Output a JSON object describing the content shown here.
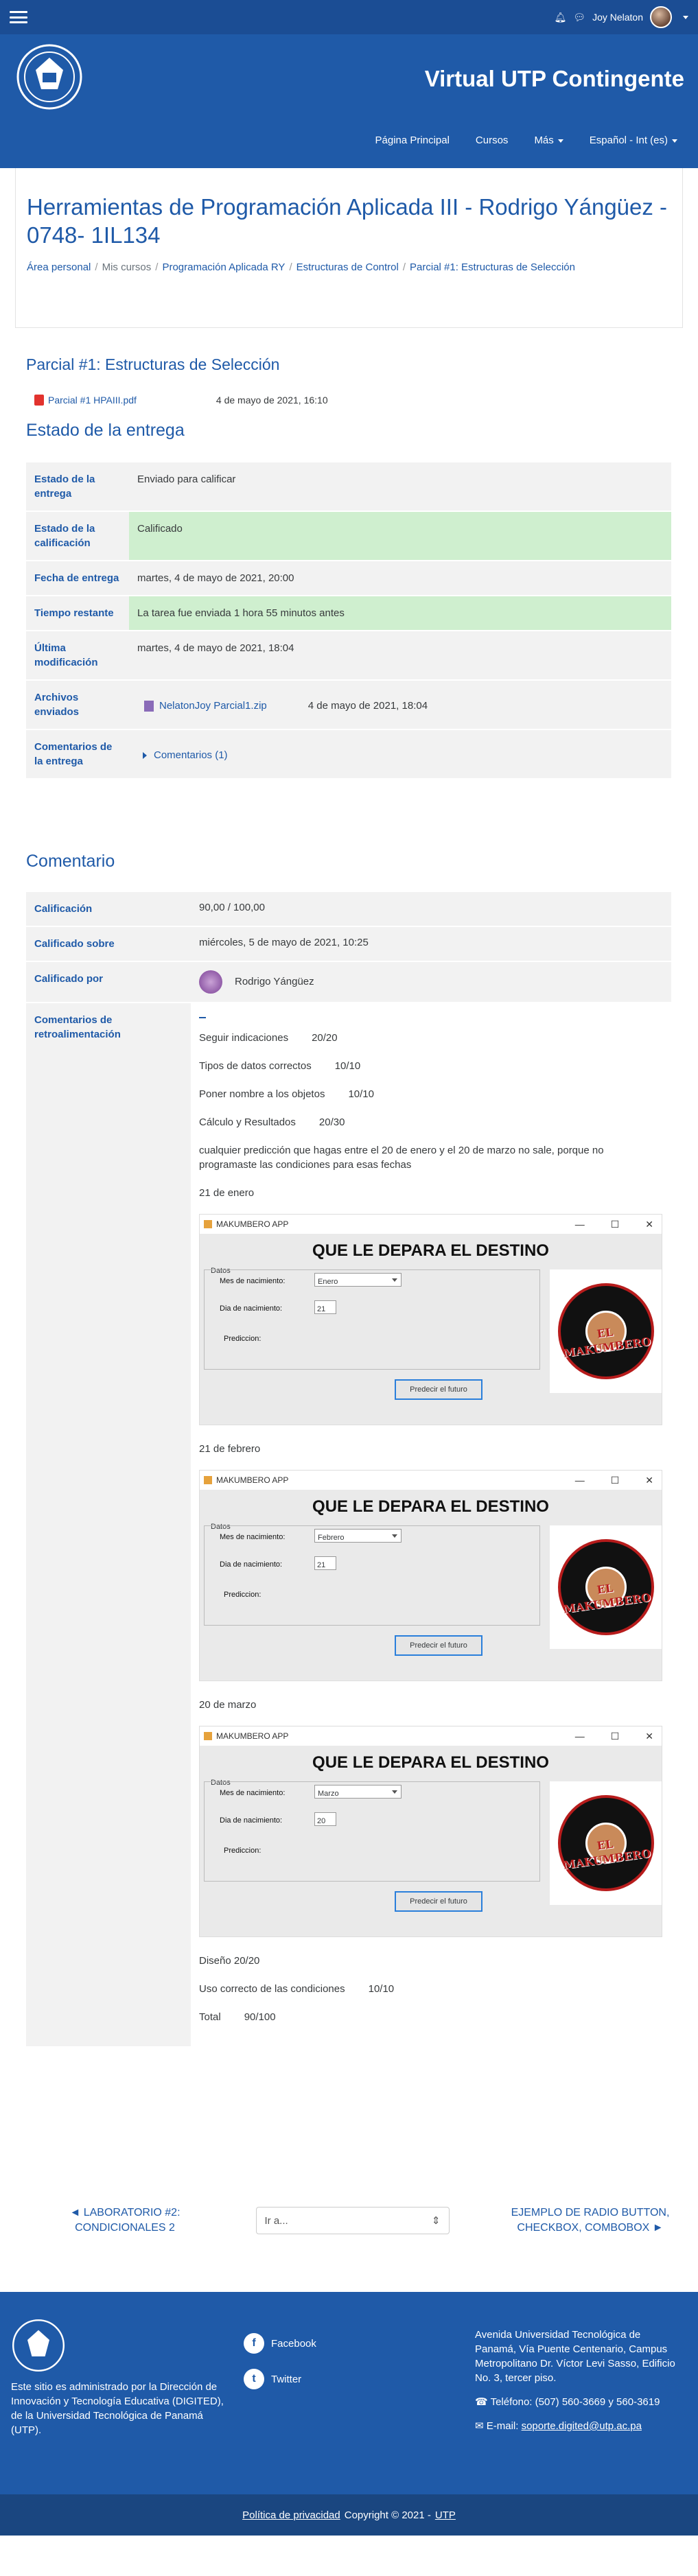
{
  "topbar": {
    "user_name": "Joy Nelaton"
  },
  "header": {
    "site_title": "Virtual UTP Contingente",
    "nav": [
      "Página Principal",
      "Cursos",
      "Más",
      "Español - Int (es)"
    ]
  },
  "course": {
    "title": "Herramientas de Programación Aplicada III - Rodrigo Yángüez - 0748- 1IL134",
    "breadcrumb": [
      "Área personal",
      "Mis cursos",
      "Programación Aplicada RY",
      "Estructuras de Control",
      "Parcial #1: Estructuras de Selección"
    ]
  },
  "activity": {
    "title": "Parcial #1: Estructuras de Selección",
    "file": "Parcial #1 HPAIII.pdf",
    "file_date": "4 de mayo de 2021, 16:10"
  },
  "submission": {
    "heading": "Estado de la entrega",
    "rows": [
      {
        "label": "Estado de la entrega",
        "value": "Enviado para calificar"
      },
      {
        "label": "Estado de la calificación",
        "value": "Calificado"
      },
      {
        "label": "Fecha de entrega",
        "value": "martes, 4 de mayo de 2021, 20:00"
      },
      {
        "label": "Tiempo restante",
        "value": "La tarea fue enviada 1 hora 55 minutos antes"
      },
      {
        "label": "Última modificación",
        "value": "martes, 4 de mayo de 2021, 18:04"
      }
    ],
    "files_label": "Archivos enviados",
    "zip_name": "NelatonJoy Parcial1.zip",
    "zip_date": "4 de mayo de 2021, 18:04",
    "comments_label": "Comentarios de la entrega",
    "comments_link": "Comentarios (1)"
  },
  "feedback": {
    "heading": "Comentario",
    "grade_label": "Calificación",
    "grade": "90,00 / 100,00",
    "graded_on_label": "Calificado sobre",
    "graded_on": "miércoles, 5 de mayo de 2021, 10:25",
    "graded_by_label": "Calificado por",
    "grader": "Rodrigo Yángüez",
    "comments_label": "Comentarios de retroalimentación",
    "items": [
      {
        "text": "Seguir indicaciones",
        "score": "20/20"
      },
      {
        "text": "Tipos de datos correctos",
        "score": "10/10"
      },
      {
        "text": "Poner nombre a los objetos",
        "score": "10/10"
      },
      {
        "text": "Cálculo y Resultados",
        "score": "20/30"
      }
    ],
    "note": "cualquier predicción que hagas entre el 20 de enero y el 20 de marzo no sale, porque no programaste las condiciones para esas fechas",
    "shots": [
      {
        "caption": "21 de enero",
        "month": "Enero",
        "day": "21"
      },
      {
        "caption": "21 de febrero",
        "month": "Febrero",
        "day": "21"
      },
      {
        "caption": "20 de marzo",
        "month": "Marzo",
        "day": "20"
      }
    ],
    "app": {
      "window_title": "MAKUMBERO APP",
      "heading": "QUE LE DEPARA EL DESTINO",
      "group": "Datos",
      "month_label": "Mes de nacimiento:",
      "day_label": "Dia de nacimiento:",
      "pred_label": "Prediccion:",
      "button": "Predecir el futuro",
      "logo_text": "EL MAKUMBERO"
    },
    "design": "Diseño 20/20",
    "cond": {
      "text": "Uso correcto de las condiciones",
      "score": "10/10"
    },
    "total": {
      "text": "Total",
      "score": "90/100"
    }
  },
  "activity_nav": {
    "prev": "◄ LABORATORIO #2: CONDICIONALES 2",
    "jump": "Ir a...",
    "next": "EJEMPLO DE RADIO BUTTON, CHECKBOX, COMBOBOX ►"
  },
  "footer": {
    "desc": "Este sitio es administrado por la Dirección de Innovación y Tecnología Educativa (DIGITED), de la Universidad Tecnológica de Panamá (UTP).",
    "facebook": "Facebook",
    "twitter": "Twitter",
    "address": "Avenida Universidad Tecnológica de Panamá, Vía Puente Centenario, Campus Metropolitano Dr. Víctor Levi Sasso, Edificio No. 3, tercer piso.",
    "phone": "Teléfono: (507) 560-3669 y 560-3619",
    "email_label": "E-mail:",
    "email": "soporte.digited@utp.ac.pa",
    "privacy": "Política de privacidad",
    "copyright": "Copyright © 2021 -",
    "utp": "UTP"
  }
}
